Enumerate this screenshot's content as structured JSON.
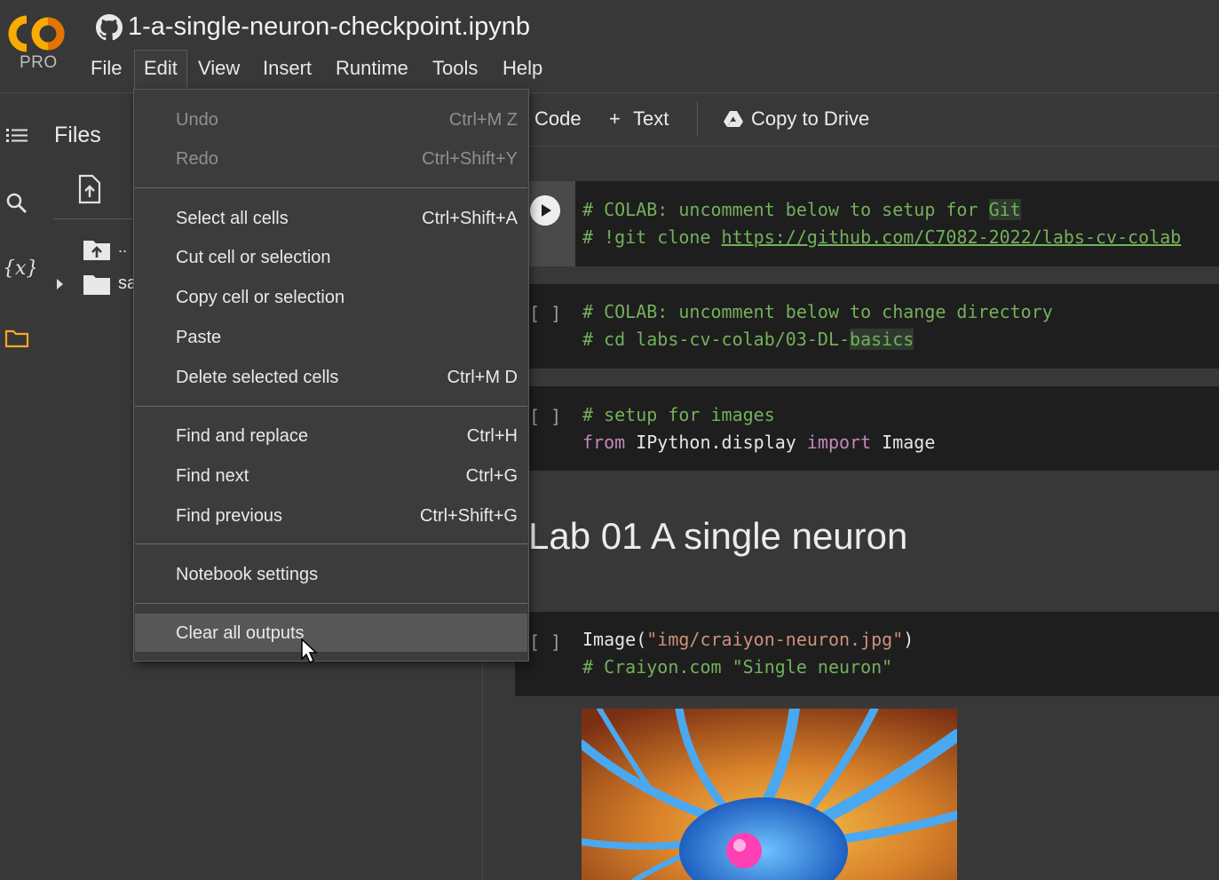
{
  "header": {
    "brand": "CO",
    "pro_label": "PRO",
    "notebook_title": "1-a-single-neuron-checkpoint.ipynb",
    "menu": [
      "File",
      "Edit",
      "View",
      "Insert",
      "Runtime",
      "Tools",
      "Help"
    ]
  },
  "rail": {
    "icons": [
      "table-of-contents-icon",
      "search-icon",
      "variables-icon",
      "files-folder-icon"
    ],
    "variables_label": "{x}"
  },
  "files_panel": {
    "title": "Files",
    "parent_dir": "..",
    "folder_name_partial": "sa"
  },
  "toolbar": {
    "code_label": "Code",
    "text_label": "Text",
    "copy_label": "Copy to Drive"
  },
  "cells": {
    "c1": {
      "line1_a": "# COLAB: uncomment below to setup for ",
      "line1_b": "Git",
      "line2_a": "# !git clone ",
      "line2_link": "https://github.com/C7082-2022/labs-cv-colab"
    },
    "c2": {
      "bracket": "[ ]",
      "line1": "# COLAB: uncomment below to change directory",
      "line2_a": "# cd labs-cv-colab/03-DL-",
      "line2_b": "basics"
    },
    "c3": {
      "bracket": "[ ]",
      "line1": "# setup for images",
      "kw_from": "from",
      "module": " IPython.display ",
      "kw_import": "import",
      "name": " Image"
    },
    "heading": "Lab 01 A single neuron",
    "c4": {
      "bracket": "[ ]",
      "fn": "Image(",
      "arg": "\"img/craiyon-neuron.jpg\"",
      "close": ")",
      "line2": "# Craiyon.com \"Single neuron\""
    }
  },
  "edit_menu": {
    "items": [
      {
        "label": "Undo",
        "shortcut": "Ctrl+M Z",
        "disabled": true
      },
      {
        "label": "Redo",
        "shortcut": "Ctrl+Shift+Y",
        "disabled": true
      },
      {
        "label": "Select all cells",
        "shortcut": "Ctrl+Shift+A"
      },
      {
        "label": "Cut cell or selection",
        "shortcut": ""
      },
      {
        "label": "Copy cell or selection",
        "shortcut": ""
      },
      {
        "label": "Paste",
        "shortcut": ""
      },
      {
        "label": "Delete selected cells",
        "shortcut": "Ctrl+M D"
      },
      {
        "label": "Find and replace",
        "shortcut": "Ctrl+H"
      },
      {
        "label": "Find next",
        "shortcut": "Ctrl+G"
      },
      {
        "label": "Find previous",
        "shortcut": "Ctrl+Shift+G"
      },
      {
        "label": "Notebook settings",
        "shortcut": ""
      },
      {
        "label": "Clear all outputs",
        "shortcut": "",
        "hovered": true
      }
    ]
  },
  "colors": {
    "background": "#383838",
    "cell_bg": "#1e1e1e",
    "comment": "#74b05b",
    "keyword": "#c586c0",
    "string": "#ce9178",
    "logo_orange": "#f9ab00"
  }
}
